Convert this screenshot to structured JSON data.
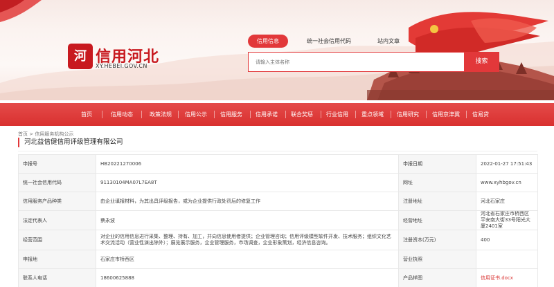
{
  "header": {
    "logo_glyph": "河",
    "site_name": "信用河北",
    "site_domain": "XY.HEBEI.GOV.CN",
    "search_tabs": [
      "信用信息",
      "统一社会信用代码",
      "站内文章"
    ],
    "search_placeholder": "请输入主体名称",
    "search_button": "搜索"
  },
  "nav": {
    "items": [
      "首页",
      "信用动态",
      "政策法规",
      "信用公示",
      "信用服务",
      "信用承诺",
      "联合奖惩",
      "行业信用",
      "重点领域",
      "信用研究",
      "信用京津冀",
      "信易贷"
    ]
  },
  "breadcrumb": {
    "home": "首页",
    "sep": ">",
    "current": "信用服务机构公示"
  },
  "page_title": "河北益信健信用评级管理有限公司",
  "details": {
    "rows": [
      {
        "l1": "申报号",
        "v1": "HB20221270006",
        "l2": "申报日期",
        "v2": "2022-01-27 17:51:43"
      },
      {
        "l1": "统一社会信用代码",
        "v1": "91130104MA07L7EA8T",
        "l2": "网址",
        "v2": "www.xyhbgov.cn"
      },
      {
        "l1": "信用服务产品种类",
        "v1": "由企业填报材料，为其出具评级报告，或为企业提供行政处罚后的修复工作",
        "l2": "注册地址",
        "v2": "河北石家庄"
      },
      {
        "l1": "法定代表人",
        "v1": "蔡永波",
        "l2": "经营地址",
        "v2": "河北省石家庄市桥西区平安南大街33号阳光大厦2401室"
      },
      {
        "l1": "经营范围",
        "v1": "对企业的信用信息进行采集、整理、持有、加工，并向信息使用者提供；企业管理咨询；信用评级模型软件开发、技术服务；组织文化艺术交流活动（营业性演出除外）；展览展示服务，企业管理服务，市场调查，企业形象策划，经济信息咨询。",
        "l2": "注册资本(万元)",
        "v2": "400"
      },
      {
        "l1": "申报地",
        "v1": "石家庄市桥西区",
        "l2": "营业执照",
        "v2": ""
      },
      {
        "l1": "联系人电话",
        "v1": "18600625888",
        "l2": "产品样图",
        "v2": "信用证书.docx"
      }
    ]
  },
  "colors": {
    "brand_red": "#e2383a",
    "nav_red": "#d9302f",
    "label_bg": "#f6f6f6"
  }
}
